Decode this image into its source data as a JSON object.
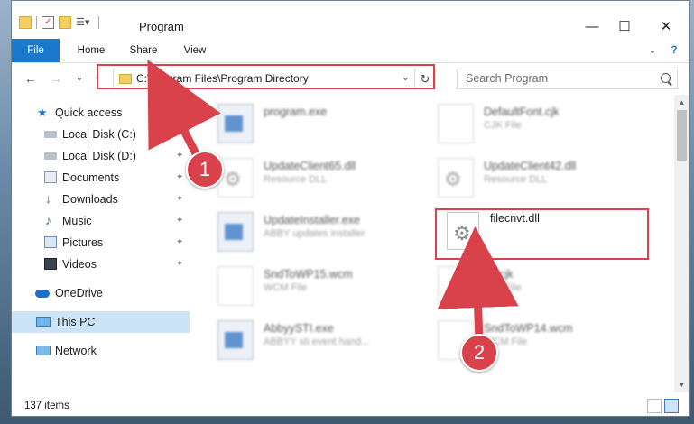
{
  "window": {
    "title": "Program",
    "minimize_glyph": "—",
    "maximize_glyph": "☐",
    "close_glyph": "✕"
  },
  "ribbon": {
    "tabs": [
      {
        "label": "File",
        "active": true
      },
      {
        "label": "Home"
      },
      {
        "label": "Share"
      },
      {
        "label": "View"
      }
    ],
    "expand_glyph": "⌄",
    "help_glyph": "?"
  },
  "address_bar": {
    "path": "C:\\Program Files\\Program Directory",
    "back_glyph": "←",
    "forward_glyph": "→",
    "recent_glyph": "⌄",
    "up_glyph": "↑",
    "dropdown_glyph": "⌄",
    "refresh_glyph": "↻"
  },
  "search": {
    "placeholder": "Search Program"
  },
  "sidebar": {
    "items": [
      {
        "label": "Quick access",
        "icon": "star-icon",
        "pinned": false
      },
      {
        "label": "Local Disk (C:)",
        "icon": "drive-icon",
        "pinned": true
      },
      {
        "label": "Local Disk (D:)",
        "icon": "drive-icon",
        "pinned": true
      },
      {
        "label": "Documents",
        "icon": "documents-icon",
        "pinned": true
      },
      {
        "label": "Downloads",
        "icon": "download-icon",
        "pinned": true
      },
      {
        "label": "Music",
        "icon": "music-icon",
        "pinned": true
      },
      {
        "label": "Pictures",
        "icon": "pictures-icon",
        "pinned": true
      },
      {
        "label": "Videos",
        "icon": "videos-icon",
        "pinned": true
      },
      {
        "label": "OneDrive",
        "icon": "cloud-icon",
        "pinned": false
      },
      {
        "label": "This PC",
        "icon": "computer-icon",
        "pinned": false,
        "selected": true
      },
      {
        "label": "Network",
        "icon": "network-icon",
        "pinned": false
      }
    ],
    "pin_glyph": "📌"
  },
  "files": [
    {
      "name": "program.exe",
      "type": "",
      "icon": "exe-icon",
      "blurred": true
    },
    {
      "name": "DefaultFont.cjk",
      "type": "CJK File",
      "icon": "file-icon",
      "blurred": true
    },
    {
      "name": "UpdateClient65.dll",
      "type": "Resource DLL",
      "icon": "dll-icon",
      "blurred": true
    },
    {
      "name": "UpdateClient42.dll",
      "type": "Resource DLL",
      "icon": "dll-icon",
      "blurred": true
    },
    {
      "name": "UpdateInstaller.exe",
      "type": "ABBY updates installer",
      "icon": "exe-icon",
      "blurred": true
    },
    {
      "name": "filecnvt.dll",
      "type": "",
      "icon": "dll-icon",
      "blurred": false,
      "highlighted": true
    },
    {
      "name": "SndToWP15.wcm",
      "type": "WCM File",
      "icon": "file-icon",
      "blurred": true
    },
    {
      "name": "bd.cjk",
      "type": "CJK File",
      "icon": "file-icon",
      "blurred": true
    },
    {
      "name": "AbbyySTI.exe",
      "type": "ABBYY sti event hand...",
      "icon": "exe-icon",
      "blurred": true
    },
    {
      "name": "SndToWP14.wcm",
      "type": "WCM File",
      "icon": "file-icon",
      "blurred": true
    }
  ],
  "status": {
    "item_count": "137 items"
  },
  "annotations": {
    "step1": "1",
    "step2": "2",
    "highlight_color": "#d9424b"
  },
  "colors": {
    "accent": "#1979ca",
    "selection": "#cce4f7"
  }
}
